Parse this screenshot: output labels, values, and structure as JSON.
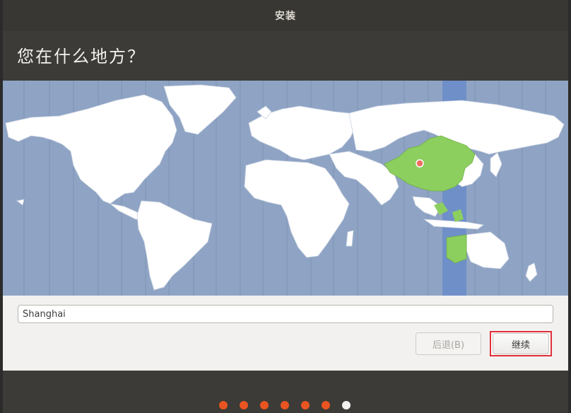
{
  "window": {
    "title": "安装"
  },
  "page": {
    "heading": "您在什么地方？"
  },
  "timezone": {
    "value": "Shanghai"
  },
  "buttons": {
    "back_label": "后退(B)",
    "continue_label": "继续"
  },
  "progress": {
    "total_steps": 7,
    "current_step": 7
  },
  "colors": {
    "accent": "#e95420",
    "map_ocean": "#8fa4c4",
    "map_land": "#ffffff",
    "selected_region": "#8ccf5e",
    "selected_timezone_band": "#6f8fc9",
    "highlight_border": "#e0303a"
  }
}
